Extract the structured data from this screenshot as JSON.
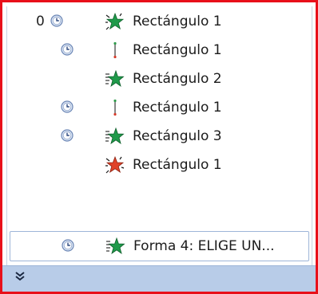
{
  "animation_pane": {
    "items": [
      {
        "order": "0",
        "label": "Rectángulo 1"
      },
      {
        "order": "",
        "label": "Rectángulo 1"
      },
      {
        "order": "",
        "label": "Rectángulo 2"
      },
      {
        "order": "",
        "label": "Rectángulo 1"
      },
      {
        "order": "",
        "label": "Rectángulo 3"
      },
      {
        "order": "",
        "label": "Rectángulo 1"
      },
      {
        "order": "",
        "label": "Forma 4: ELIGE UN..."
      }
    ],
    "icons": {
      "timing": "clock-icon",
      "entrance": "green-star-effect-icon",
      "motion": "motion-path-icon",
      "exit": "red-star-effect-icon",
      "expand": "double-chevron-down-icon"
    },
    "colors": {
      "border": "#e8101a",
      "selection_border": "#9db5d8",
      "expand_bar": "#b8cce8",
      "entrance_star": "#1f9a4a",
      "exit_star": "#e0432a"
    }
  }
}
